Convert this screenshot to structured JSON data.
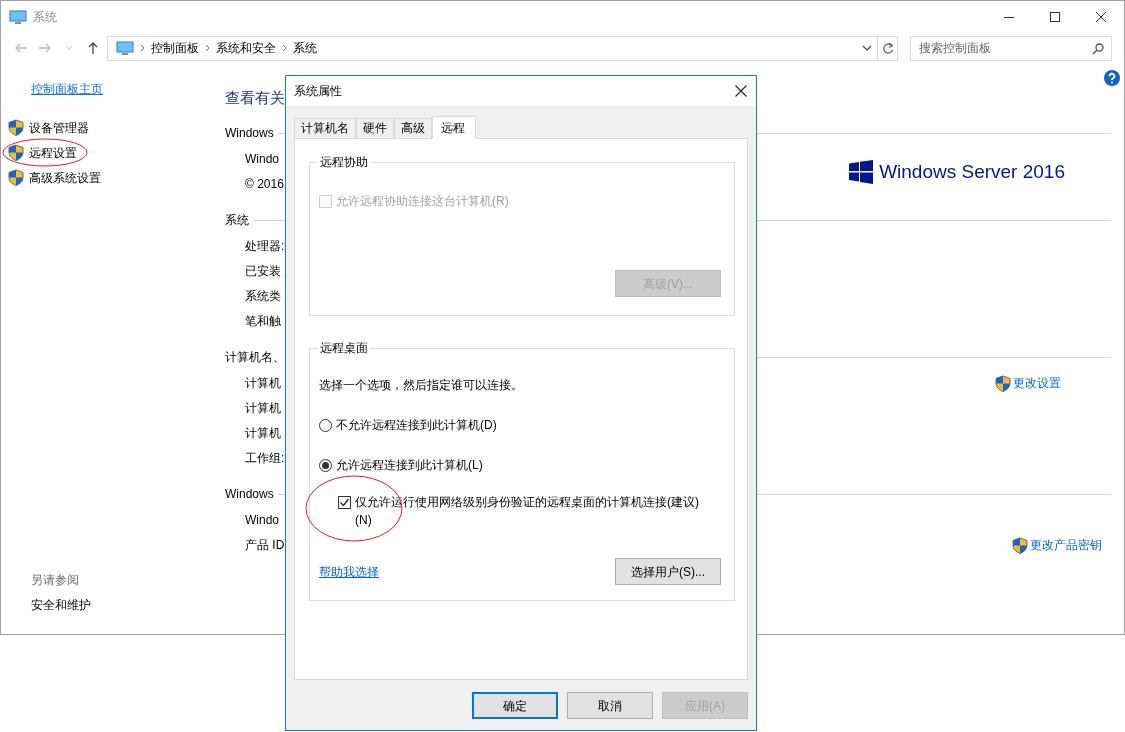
{
  "window": {
    "title": "系统"
  },
  "address_bar": {
    "breadcrumbs": [
      "控制面板",
      "系统和安全",
      "系统"
    ]
  },
  "search": {
    "placeholder": "搜索控制面板"
  },
  "sidebar": {
    "home": "控制面板主页",
    "items": [
      {
        "label": "设备管理器",
        "circled": false
      },
      {
        "label": "远程设置",
        "circled": true
      },
      {
        "label": "高级系统设置",
        "circled": false
      }
    ],
    "see_also": {
      "heading": "另请参阅",
      "links": [
        "安全和维护"
      ]
    }
  },
  "main": {
    "heading": "查看有关",
    "sections": [
      {
        "title": "Windows",
        "rows": [
          "Windo",
          "© 2016"
        ],
        "aside": {
          "kind": "logo",
          "text": "Windows Server 2016"
        }
      },
      {
        "title": "系统",
        "rows": [
          "处理器:",
          "已安装",
          "系统类",
          "笔和触"
        ]
      },
      {
        "title": "计算机名、",
        "rows": [
          "计算机",
          "计算机",
          "计算机",
          "工作组:"
        ],
        "aside": {
          "kind": "link",
          "text": "更改设置"
        }
      },
      {
        "title": "Windows",
        "rows": [
          "Windo",
          "产品 ID"
        ],
        "aside": {
          "kind": "link",
          "text": "更改产品密钥"
        }
      }
    ]
  },
  "dialog": {
    "title": "系统属性",
    "tabs": [
      {
        "label": "计算机名",
        "selected": false
      },
      {
        "label": "硬件",
        "selected": false
      },
      {
        "label": "高级",
        "selected": false
      },
      {
        "label": "远程",
        "selected": true
      }
    ],
    "remote_assistance": {
      "title": "远程协助",
      "checkbox": {
        "label": "允许远程协助连接这台计算机(R)",
        "checked": false,
        "disabled": true
      },
      "button": {
        "label": "高级(V)...",
        "disabled": true
      }
    },
    "remote_desktop": {
      "title": "远程桌面",
      "instruction": "选择一个选项，然后指定谁可以连接。",
      "options": [
        {
          "label": "不允许远程连接到此计算机(D)",
          "selected": false
        },
        {
          "label": "允许远程连接到此计算机(L)",
          "selected": true
        }
      ],
      "nla": {
        "label": "仅允许运行使用网络级别身份验证的远程桌面的计算机连接(建议)(N)",
        "checked": true,
        "circled": true
      },
      "help_link": "帮助我选择",
      "button": {
        "label": "选择用户(S)...",
        "disabled": false
      }
    },
    "buttons": [
      {
        "label": "确定",
        "default": true,
        "disabled": false
      },
      {
        "label": "取消",
        "default": false,
        "disabled": false
      },
      {
        "label": "应用(A)",
        "default": false,
        "disabled": true
      }
    ]
  }
}
